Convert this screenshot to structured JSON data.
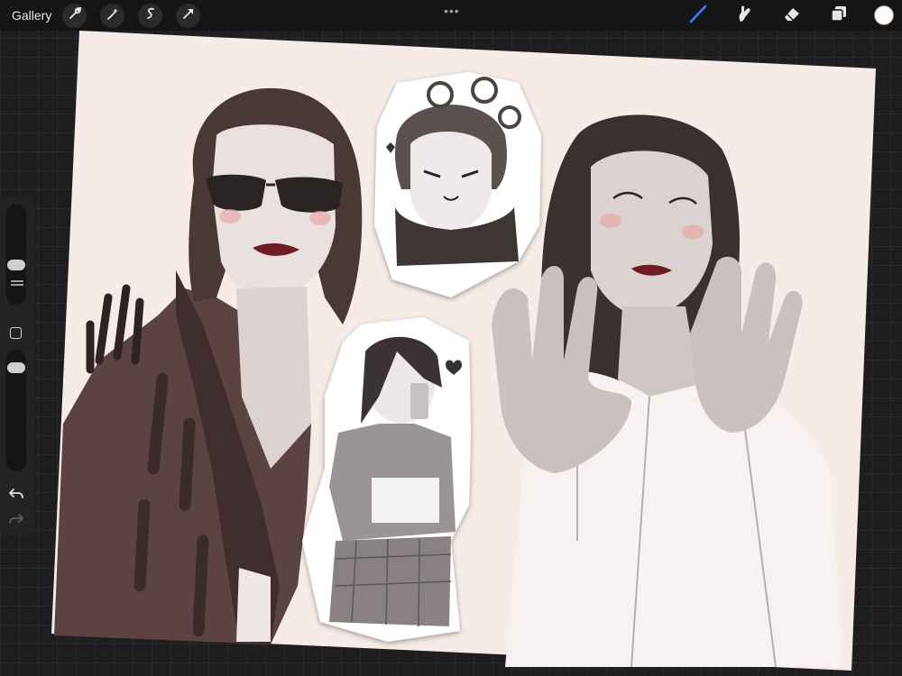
{
  "topbar": {
    "gallery_label": "Gallery",
    "left_tools": [
      "wrench-icon",
      "magic-wand-icon",
      "selection-icon",
      "transform-arrow-icon"
    ],
    "more_label": "•••",
    "right_tools": [
      "brush-icon",
      "smudge-icon",
      "eraser-icon",
      "layers-icon"
    ],
    "current_color": "#fffaf6",
    "active_tool_color": "#3a7bff"
  },
  "sidebar": {
    "controls": [
      "brush-size-slider",
      "modify-button",
      "opacity-slider",
      "undo-button",
      "redo-button"
    ]
  },
  "canvas": {
    "background_color": "#f6ebe7",
    "content": "artwork"
  }
}
